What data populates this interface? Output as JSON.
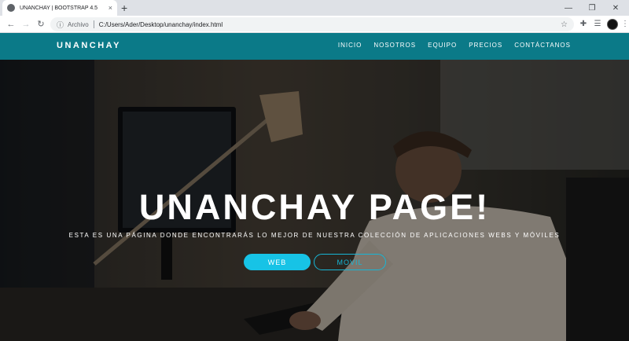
{
  "browser": {
    "tab_title": "UNANCHAY | BOOTSTRAP 4.5",
    "tab_close": "×",
    "new_tab": "+",
    "minimize": "—",
    "restore": "❐",
    "close": "✕",
    "back": "←",
    "forward": "→",
    "reload": "↻",
    "info_icon": "ⓘ",
    "origin_label": "Archivo",
    "url": "C:/Users/Ader/Desktop/unanchay/index.html",
    "star": "☆",
    "extensions": "✚",
    "reading_list": "☰",
    "menu": "⋮"
  },
  "navbar": {
    "brand": "UNANCHAY",
    "items": [
      "INICIO",
      "NOSOTROS",
      "EQUIPO",
      "PRECIOS",
      "CONTÁCTANOS"
    ]
  },
  "hero": {
    "title": "UNANCHAY PAGE!",
    "subtitle": "ESTA ES UNA PÁGINA DONDE ENCONTRARÁS LO MEJOR DE NUESTRA COLECCIÓN DE APLICACIONES WEBS Y MÓVILES",
    "button_primary": "WEB",
    "button_secondary": "MOVIL"
  },
  "colors": {
    "navbar_bg": "#0b7a88",
    "accent": "#17c3e6",
    "tabstrip_bg": "#dee1e6"
  }
}
